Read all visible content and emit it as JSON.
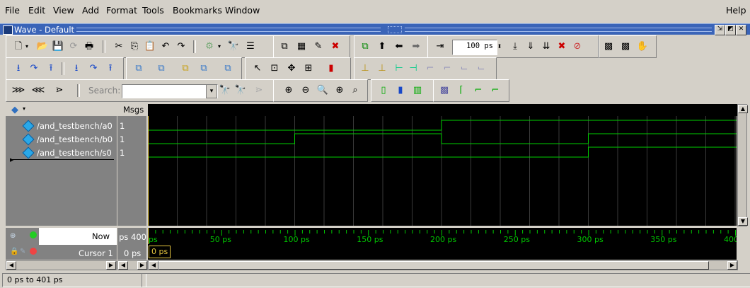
{
  "menubar": {
    "items": [
      "File",
      "Edit",
      "View",
      "Add",
      "Format",
      "Tools",
      "Bookmarks",
      "Window"
    ],
    "help": "Help"
  },
  "window": {
    "title": "Wave - Default"
  },
  "toolbar": {
    "time_step_value": "100 ps",
    "search_label": "Search:",
    "search_value": ""
  },
  "wave": {
    "header_msgs": "Msgs",
    "signals": [
      {
        "name": "/and_testbench/a0",
        "value": "1"
      },
      {
        "name": "/and_testbench/b0",
        "value": "1"
      },
      {
        "name": "/and_testbench/s0",
        "value": "1"
      }
    ],
    "now_label": "Now",
    "now_value": "400 ps",
    "cursor_label": "Cursor 1",
    "cursor_value": "0 ps",
    "cursor_marker": "0 ps"
  },
  "timeline": {
    "ticks": [
      "ps",
      "50 ps",
      "100 ps",
      "150 ps",
      "200 ps",
      "250 ps",
      "300 ps",
      "350 ps",
      "400"
    ]
  },
  "status": {
    "range": "0 ps to 401 ps"
  },
  "colors": {
    "wave": "#00d000",
    "grid": "#3a3a3a",
    "timeline_text": "#00c800",
    "cursor": "#e8c840"
  }
}
